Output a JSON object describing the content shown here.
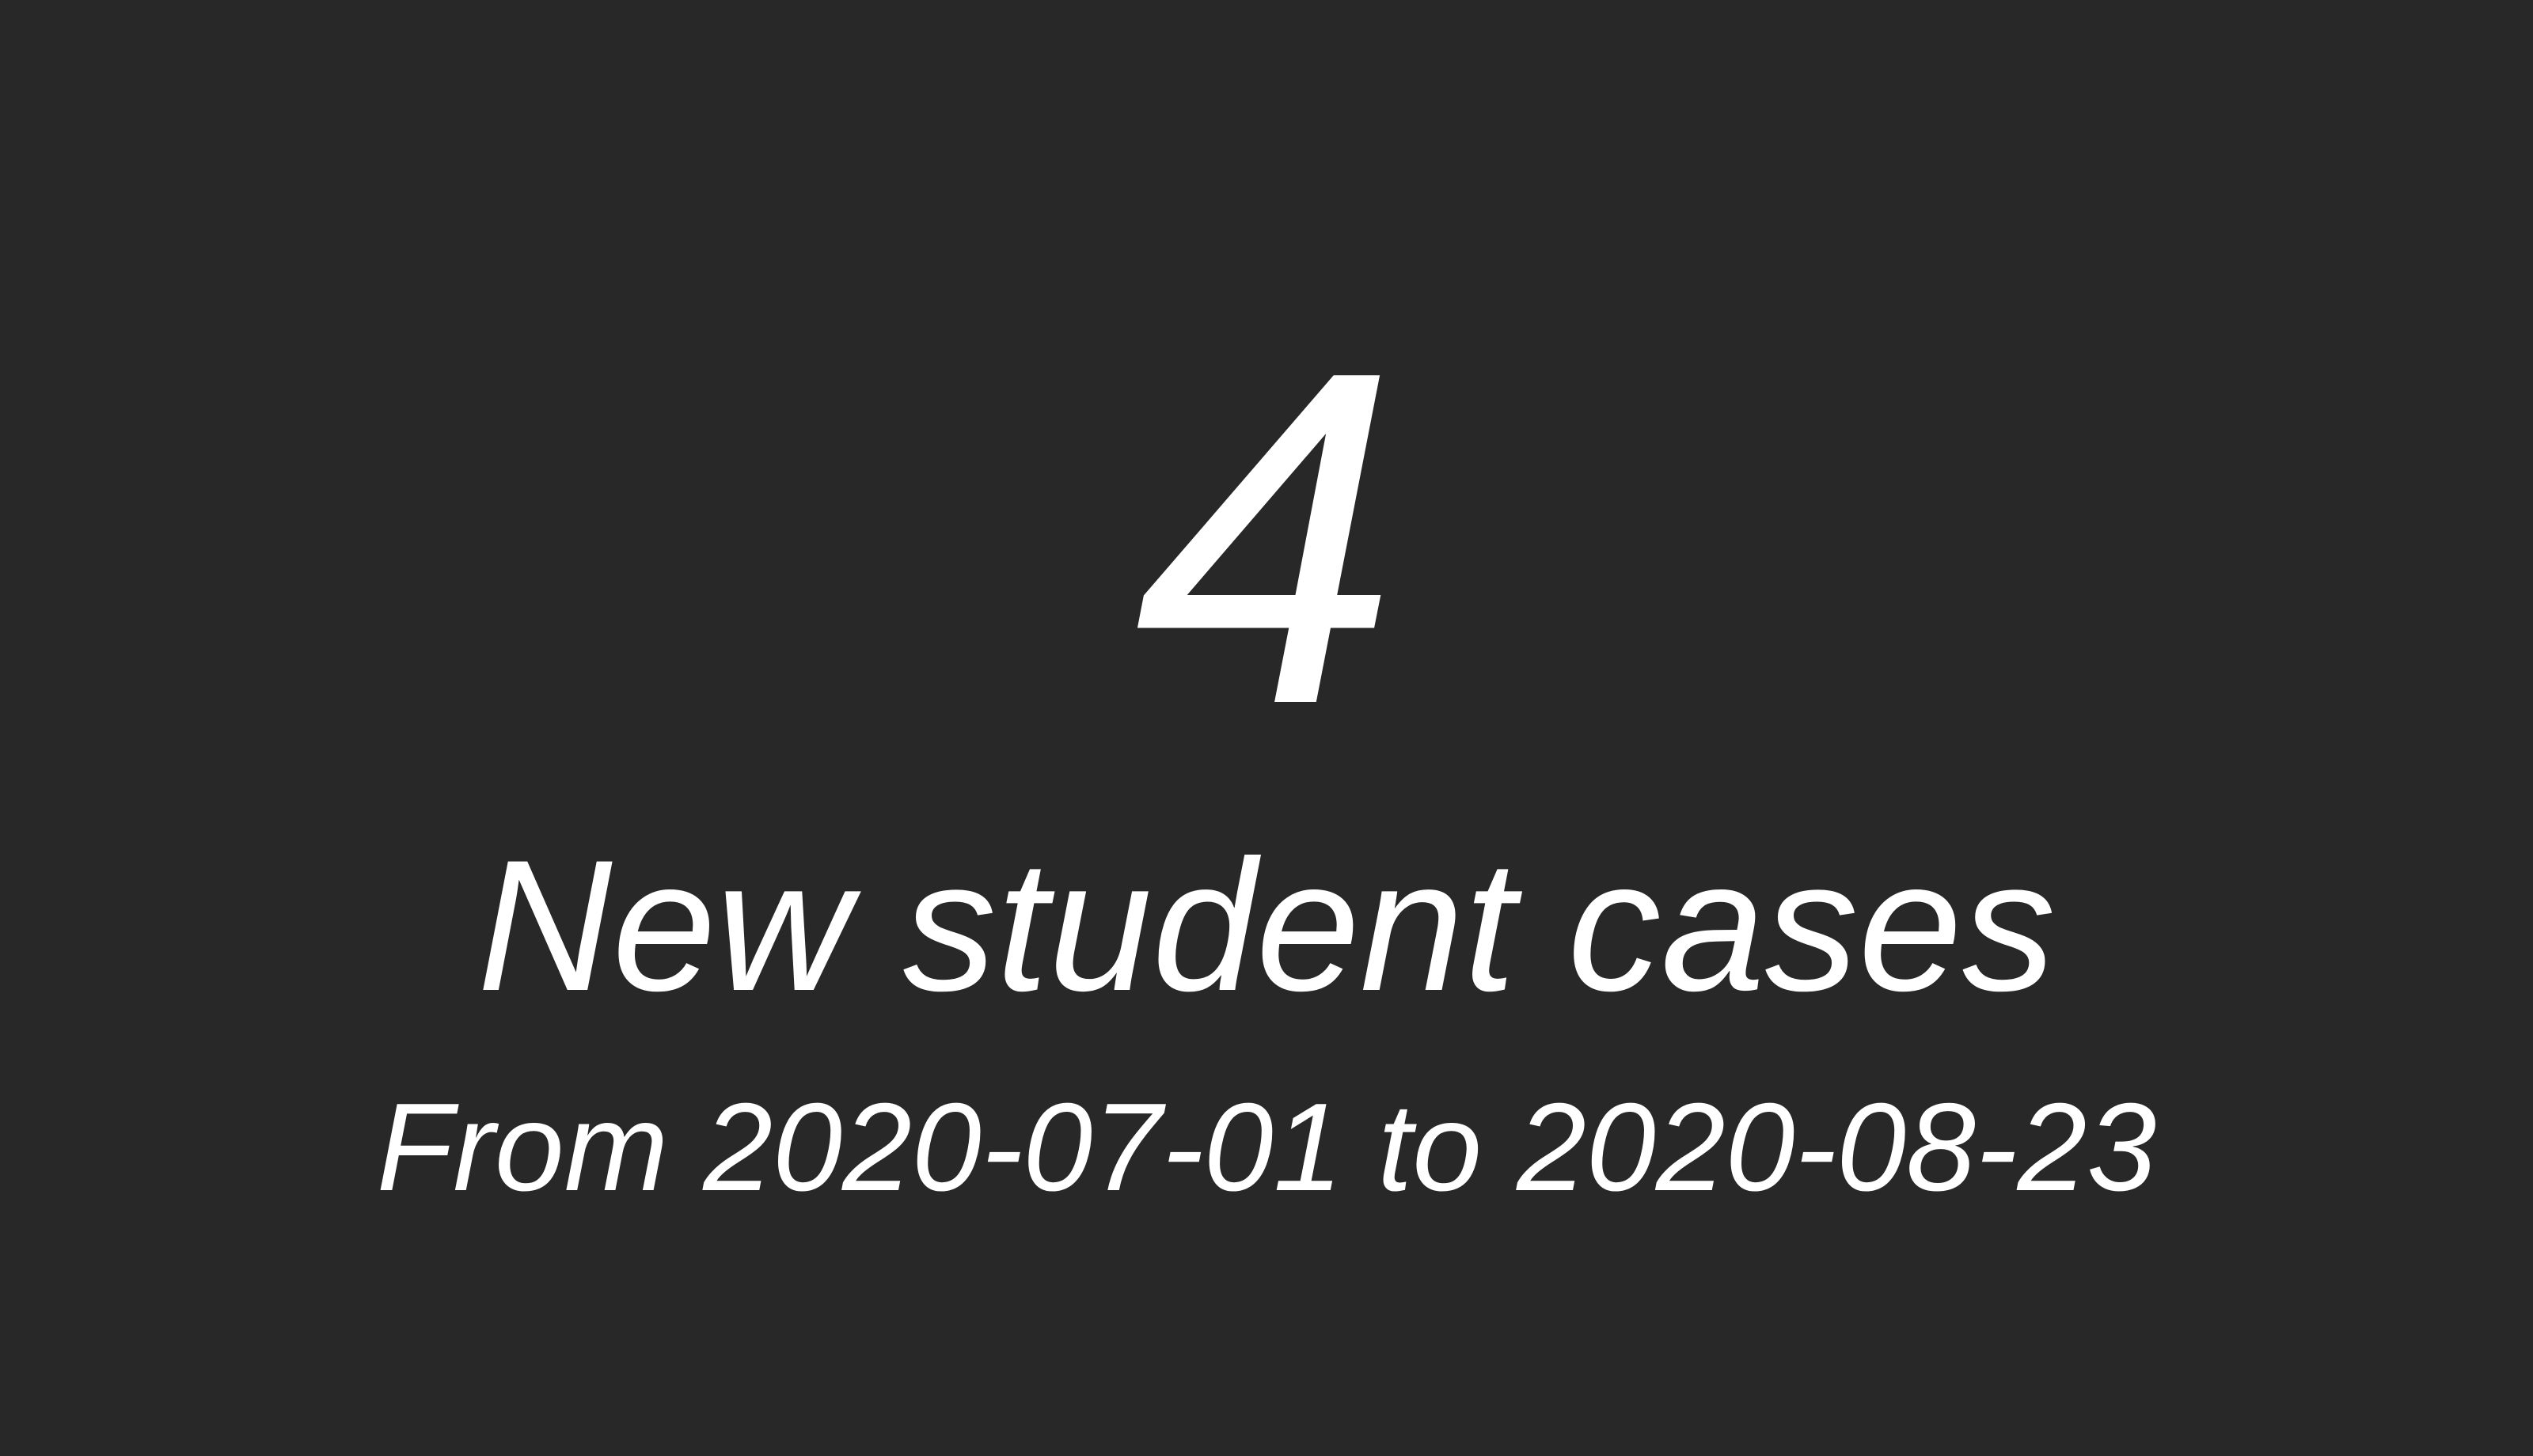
{
  "stat": {
    "value": "4",
    "label": "New student cases",
    "date_range": "From 2020-07-01 to 2020-08-23"
  },
  "colors": {
    "background": "#282828",
    "text": "#ffffff"
  }
}
